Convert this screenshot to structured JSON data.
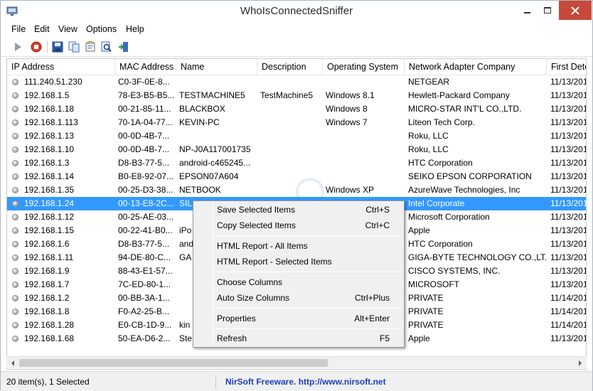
{
  "window": {
    "title": "WhoIsConnectedSniffer"
  },
  "menu": [
    "File",
    "Edit",
    "View",
    "Options",
    "Help"
  ],
  "toolbar_icons": [
    "play-icon",
    "stop-icon",
    "save-icon",
    "copy-icon",
    "html-report-icon",
    "find-icon",
    "exit-icon"
  ],
  "table": {
    "columns": [
      "IP Address",
      "MAC Address",
      "Name",
      "Description",
      "Operating System",
      "Network Adapter Company",
      "First Detec"
    ],
    "rows": [
      [
        "111.240.51.230",
        "C0-3F-0E-8...",
        "",
        "",
        "",
        "NETGEAR",
        "11/13/201"
      ],
      [
        "192.168.1.5",
        "78-E3-B5-B5...",
        "TESTMACHINE5",
        "TestMachine5",
        "Windows 8.1",
        "Hewlett-Packard Company",
        "11/13/201"
      ],
      [
        "192.168.1.18",
        "00-21-85-11...",
        "BLACKBOX",
        "",
        "Windows 8",
        "MICRO-STAR INT'L CO.,LTD.",
        "11/13/201"
      ],
      [
        "192.168.1.113",
        "70-1A-04-77...",
        "KEVIN-PC",
        "",
        "Windows 7",
        "Liteon Tech Corp.",
        "11/13/201"
      ],
      [
        "192.168.1.13",
        "00-0D-4B-7...",
        "",
        "",
        "",
        "Roku, LLC",
        "11/13/201"
      ],
      [
        "192.168.1.10",
        "00-0D-4B-7...",
        "NP-J0A117001735",
        "",
        "",
        "Roku, LLC",
        "11/13/201"
      ],
      [
        "192.168.1.3",
        "D8-B3-77-5...",
        "android-c465245...",
        "",
        "",
        "HTC Corporation",
        "11/13/201"
      ],
      [
        "192.168.1.14",
        "B0-E8-92-07...",
        "EPSON07A604",
        "",
        "",
        "SEIKO EPSON CORPORATION",
        "11/13/201"
      ],
      [
        "192.168.1.35",
        "00-25-D3-38...",
        "NETBOOK",
        "",
        "Windows XP",
        "AzureWave Technologies, Inc",
        "11/13/201"
      ],
      [
        "192.168.1.24",
        "00-13-E8-2C...",
        "SIL",
        "",
        "",
        "Intel Corporate",
        "11/13/201"
      ],
      [
        "192.168.1.12",
        "00-25-AE-03...",
        "",
        "",
        "",
        "Microsoft Corporation",
        "11/13/201"
      ],
      [
        "192.168.1.15",
        "00-22-41-B0...",
        "iPo",
        "",
        "",
        "Apple",
        "11/13/201"
      ],
      [
        "192.168.1.6",
        "D8-B3-77-5...",
        "and",
        "",
        "",
        "HTC Corporation",
        "11/13/201"
      ],
      [
        "192.168.1.11",
        "94-DE-80-C...",
        "GA",
        "",
        "",
        "GIGA-BYTE TECHNOLOGY CO.,LT...",
        "11/13/201"
      ],
      [
        "192.168.1.9",
        "88-43-E1-57...",
        "",
        "",
        "",
        "CISCO SYSTEMS, INC.",
        "11/13/201"
      ],
      [
        "192.168.1.7",
        "7C-ED-80-1...",
        "",
        "",
        "",
        "MICROSOFT",
        "11/13/201"
      ],
      [
        "192.168.1.2",
        "00-BB-3A-1...",
        "",
        "",
        "",
        "PRIVATE",
        "11/14/201"
      ],
      [
        "192.168.1.8",
        "F0-A2-25-B...",
        "",
        "",
        "",
        "PRIVATE",
        "11/14/201"
      ],
      [
        "192.168.1.28",
        "E0-CB-1D-9...",
        "kin",
        "",
        "",
        "PRIVATE",
        "11/14/201"
      ],
      [
        "192.168.1.68",
        "50-EA-D6-2...",
        "Ste",
        "",
        "",
        "Apple",
        "11/13/201"
      ]
    ],
    "selected_row": 9
  },
  "context_menu": [
    {
      "label": "Save Selected Items",
      "shortcut": "Ctrl+S"
    },
    {
      "label": "Copy Selected Items",
      "shortcut": "Ctrl+C"
    },
    {
      "label": "HTML Report - All Items",
      "shortcut": ""
    },
    {
      "label": "HTML Report - Selected Items",
      "shortcut": ""
    },
    {
      "label": "Choose Columns",
      "shortcut": ""
    },
    {
      "label": "Auto Size Columns",
      "shortcut": "Ctrl+Plus"
    },
    {
      "label": "Properties",
      "shortcut": "Alt+Enter"
    },
    {
      "label": "Refresh",
      "shortcut": "F5"
    }
  ],
  "status": {
    "count": "20 item(s), 1 Selected",
    "link": "NirSoft Freeware.  http://www.nirsoft.net"
  },
  "colors": {
    "selection": "#3399ff",
    "close_button": "#c7493a",
    "link": "#1a3fbf"
  }
}
